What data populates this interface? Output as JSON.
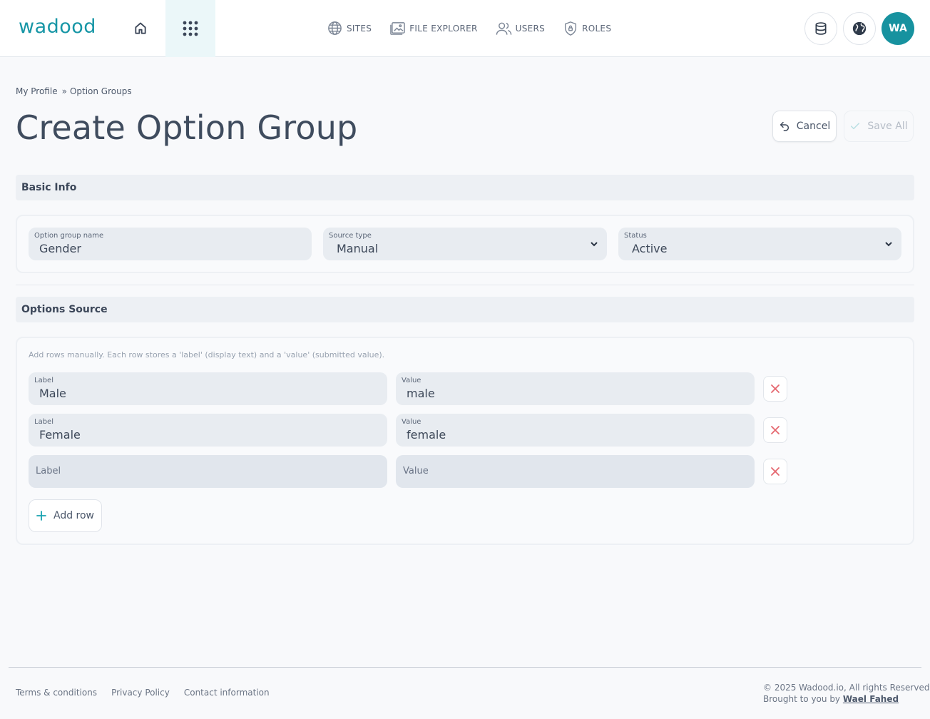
{
  "header": {
    "logo": "wadood",
    "nav": [
      {
        "label": "SITES",
        "icon": "globe-icon"
      },
      {
        "label": "FILE EXPLORER",
        "icon": "folder-image-icon"
      },
      {
        "label": "USERS",
        "icon": "users-icon"
      },
      {
        "label": "ROLES",
        "icon": "shield-icon"
      }
    ],
    "avatar_initials": "WA",
    "accent_color": "#17929f"
  },
  "breadcrumb": {
    "items": [
      "My Profile",
      "Option Groups"
    ],
    "separator": "»"
  },
  "page": {
    "title": "Create Option Group",
    "cancel_label": "Cancel",
    "save_label": "Save All"
  },
  "basic_info": {
    "section_title": "Basic Info",
    "name": {
      "label": "Option group name",
      "value": "Gender"
    },
    "source_type": {
      "label": "Source type",
      "value": "Manual"
    },
    "status": {
      "label": "Status",
      "value": "Active"
    }
  },
  "options_source": {
    "section_title": "Options Source",
    "hint": "Add rows manually. Each row stores a 'label' (display text) and a 'value' (submitted value).",
    "rows": [
      {
        "label_caption": "Label",
        "label": "Male",
        "value_caption": "Value",
        "value": "male"
      },
      {
        "label_caption": "Label",
        "label": "Female",
        "value_caption": "Value",
        "value": "female"
      }
    ],
    "empty_row": {
      "label_placeholder": "Label",
      "value_placeholder": "Value"
    },
    "add_row_label": "Add row"
  },
  "footer": {
    "links": [
      "Terms & conditions",
      "Privacy Policy",
      "Contact information"
    ],
    "copyright": "© 2025 Wadood.io, All rights Reserved",
    "brought_by": "Brought to you by",
    "author": "Wael Fahed"
  }
}
